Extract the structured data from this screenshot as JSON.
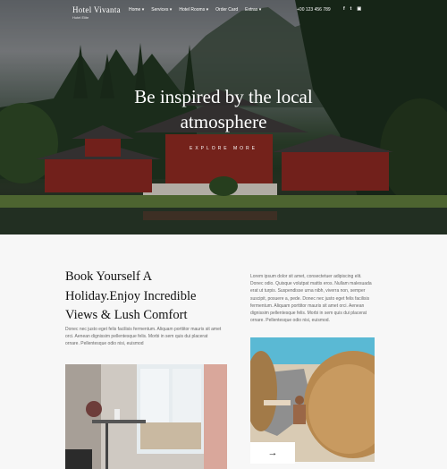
{
  "brand": {
    "name": "Hotel Vivanta",
    "sub": "Hotel Elite"
  },
  "nav": {
    "items": [
      "Home ▾",
      "Services ▾",
      "Hotel Rooms ▾",
      "Order Card",
      "Extras ▾"
    ],
    "phone": "+00 123 456 789",
    "socials": [
      {
        "icon": "facebook-icon",
        "glyph": "f"
      },
      {
        "icon": "twitter-icon",
        "glyph": "t"
      },
      {
        "icon": "instagram-icon",
        "glyph": "▣"
      }
    ]
  },
  "hero": {
    "title_line1": "Be inspired by the local",
    "title_line2": "atmosphere",
    "button": "EXPLORE MORE"
  },
  "intro": {
    "heading_line1": "Book Yourself A",
    "heading_line2": "Holiday.Enjoy Incredible",
    "heading_line3": "Views & Lush Comfort",
    "left_text": "Donec nec justo eget felis facilisis fermentum. Aliquam porttitor mauris sit amet orci. Aenean dignissim pellentesque felis. Morbi in sem quis dui placerat ornare. Pellentesque odio nisi, euismod",
    "right_text": "Lorem ipsum dolor sit amet, consectetuer adipiscing elit. Donec odio. Quisque volutpat mattis eros. Nullam malesuada erat ut turpis. Suspendisse urna nibh, viverra non, semper suscipit, posuere a, pede. Donec nec justo eget felis facilisis fermentum. Aliquam porttitor mauris sit amet orci. Aenean dignissim pellentesque felis. Morbi in sem quis dui placerat ornare. Pellentesque odio nisi, euismod.",
    "arrow": "→"
  }
}
